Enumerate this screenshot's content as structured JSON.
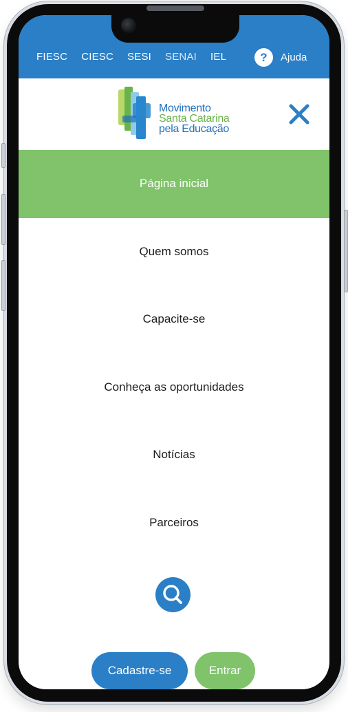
{
  "topbar": {
    "links": [
      "FIESC",
      "CIESC",
      "SESI",
      "SENAI",
      "IEL"
    ],
    "help_label": "Ajuda",
    "help_glyph": "?",
    "color": "#2a7fc6"
  },
  "brand": {
    "logo_line1": "Movimento",
    "logo_line2": "Santa Catarina",
    "logo_line3": "pela Educação",
    "icon": "close-icon"
  },
  "menu": {
    "items": [
      "Página inicial",
      "Quem somos",
      "Capacite-se",
      "Conheça as oportunidades",
      "Notícias",
      "Parceiros"
    ],
    "active_index": 0,
    "active_color": "#80c36b"
  },
  "actions": {
    "search_icon": "search-icon",
    "signup_label": "Cadastre-se",
    "login_label": "Entrar"
  }
}
